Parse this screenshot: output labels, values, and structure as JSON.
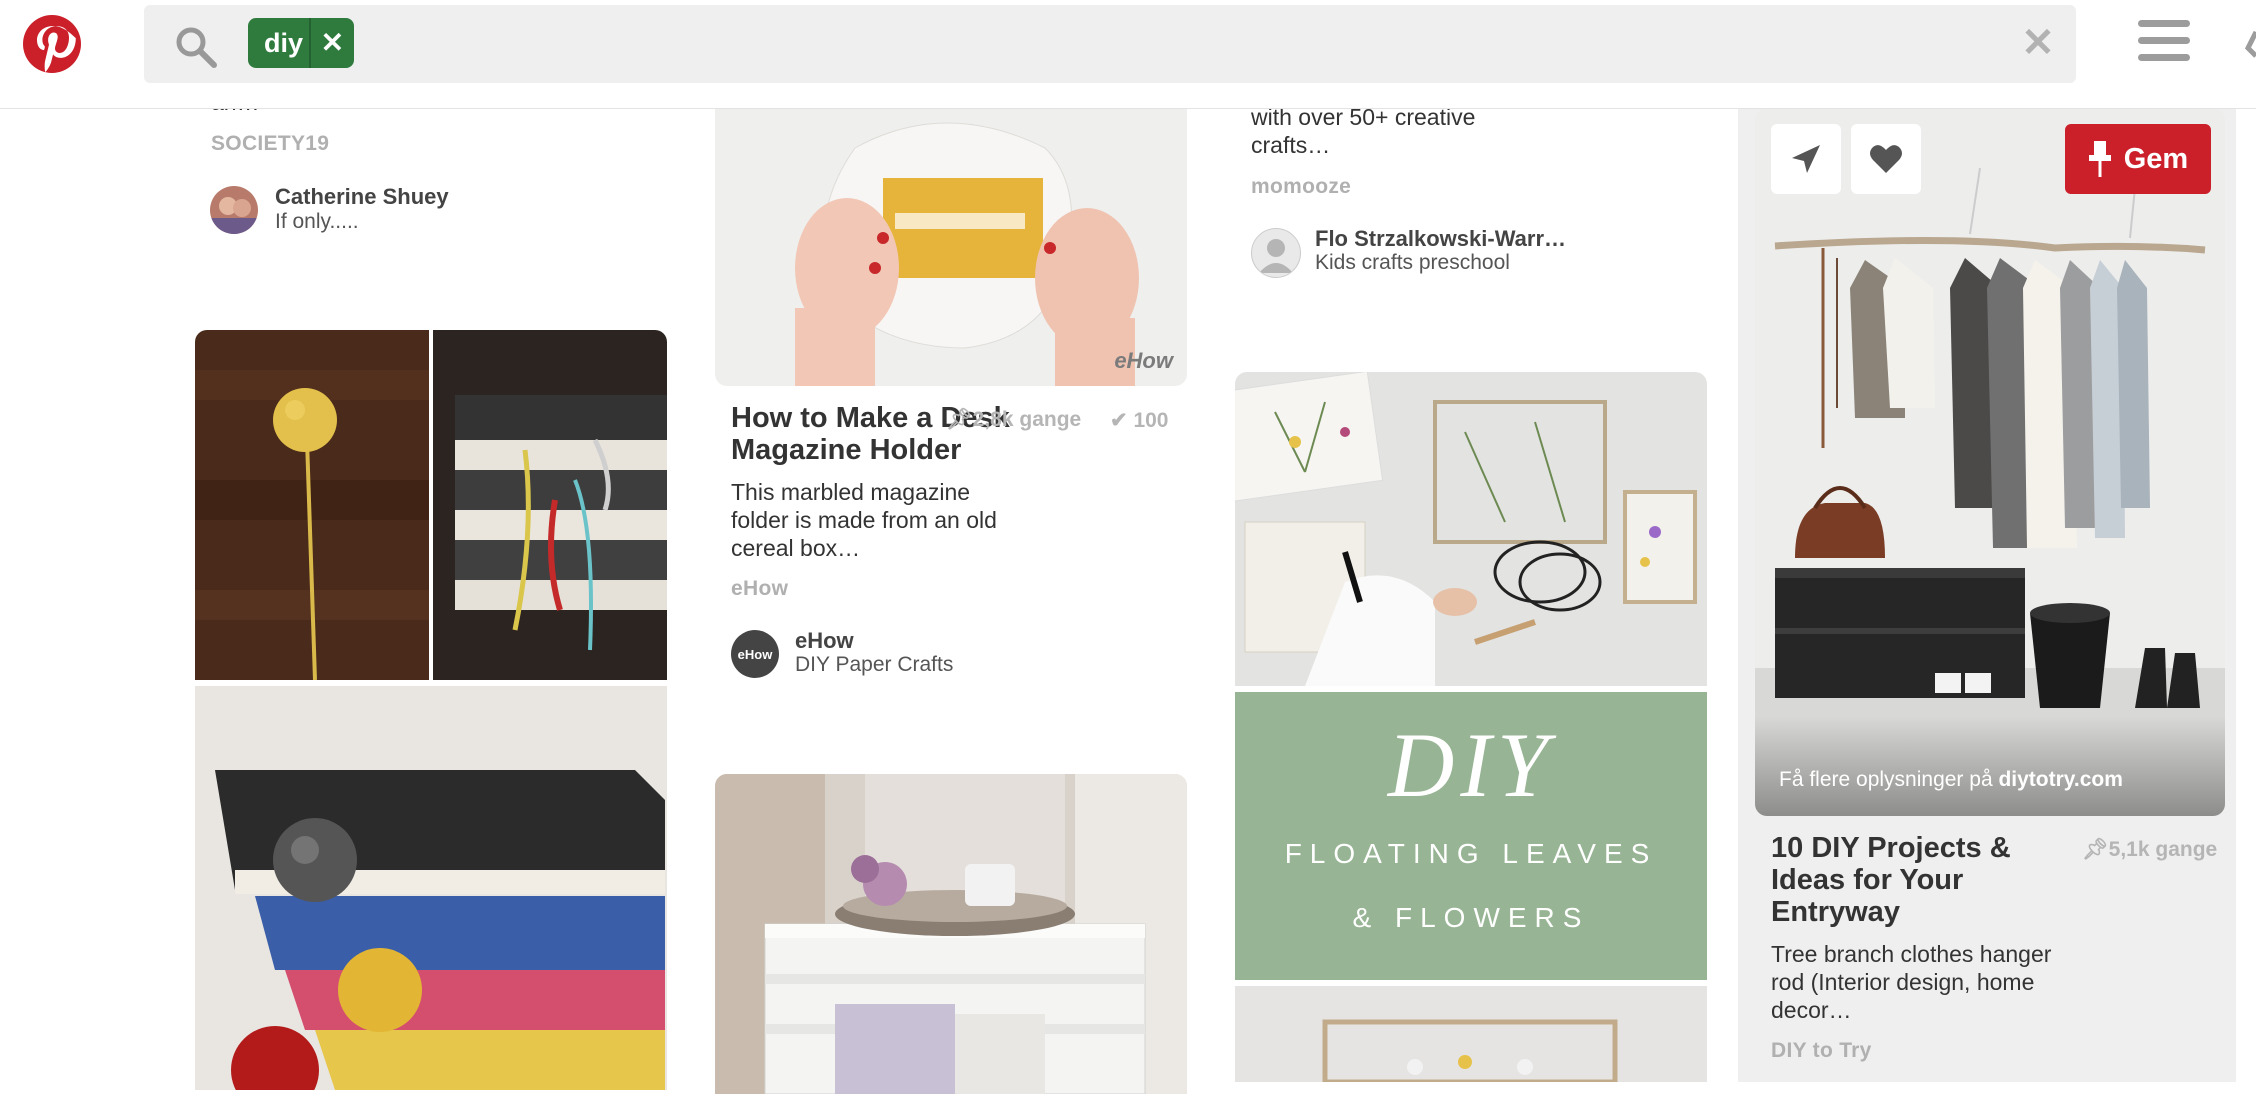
{
  "header": {
    "search_chip_label": "diy"
  },
  "pins": {
    "society": {
      "desc_fragment": "an…",
      "source": "SOCIETY19",
      "user": "Catherine Shuey",
      "board": "If only....."
    },
    "ehow": {
      "watermark": "eHow",
      "title_line1": "How to Make a Desk",
      "title_line2": "Magazine Holder",
      "pins_count": "2,8k gange",
      "tried_count": "100",
      "desc_line1": "This marbled magazine",
      "desc_line2": "folder is made from an old",
      "desc_line3": "cereal box…",
      "source": "eHow",
      "avatar_text": "eHow",
      "user": "eHow",
      "board": "DIY Paper Crafts"
    },
    "momooze": {
      "desc_line1": "with over 50+ creative",
      "desc_line2": "crafts…",
      "source": "momooze",
      "user": "Flo Strzalkowski-Warr…",
      "board": "Kids crafts preschool"
    },
    "floating": {
      "big_text": "DIY",
      "line1": "FLOATING LEAVES",
      "line2": "& FLOWERS"
    },
    "entryway": {
      "gem_label": "Gem",
      "more_info_prefix": "Få flere oplysninger på ",
      "more_info_domain": "diytotry.com",
      "title_line1": "10 DIY Projects &",
      "title_line2": "Ideas for Your",
      "title_line3": "Entryway",
      "pins_count": "5,1k gange",
      "desc_line1": "Tree branch clothes hanger",
      "desc_line2": "rod (Interior design, home",
      "desc_line3": "decor…",
      "source": "DIY to Try"
    }
  },
  "colors": {
    "brand_red": "#cb1f2a",
    "chip_green": "#2f7b3e",
    "floating_green": "#97b594"
  }
}
